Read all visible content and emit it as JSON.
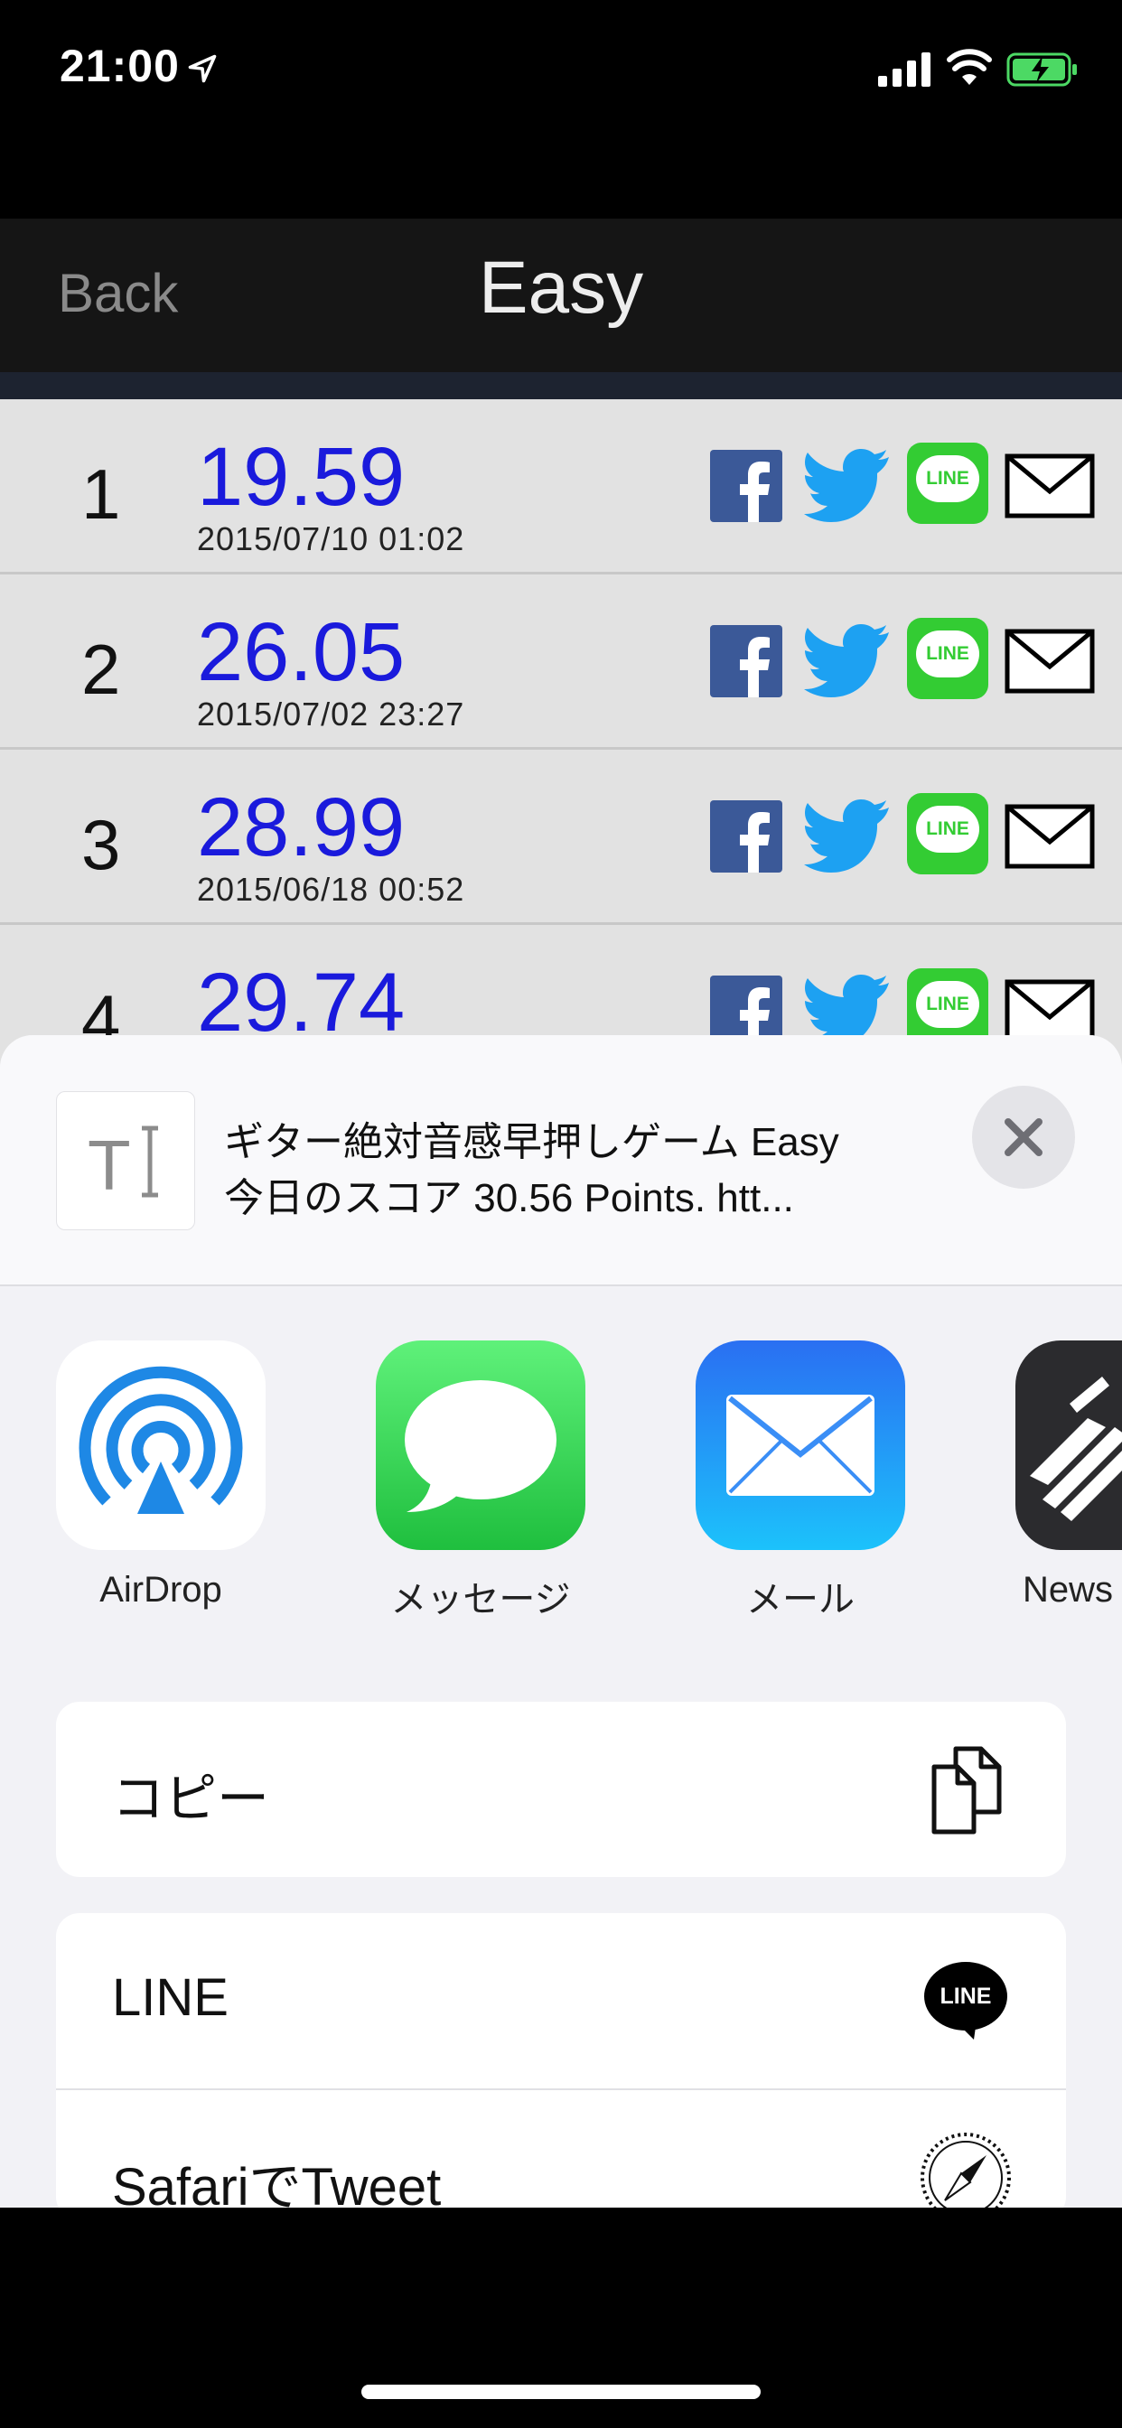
{
  "status_bar": {
    "time": "21:00",
    "icons": [
      "location-arrow-icon",
      "cellular-signal-icon",
      "wifi-icon",
      "battery-charging-icon"
    ],
    "battery_color": "#4cd964"
  },
  "nav": {
    "back_label": "Back",
    "title": "Easy"
  },
  "scores": [
    {
      "rank": "1",
      "score": "19.59",
      "date": "2015/07/10  01:02"
    },
    {
      "rank": "2",
      "score": "26.05",
      "date": "2015/07/02  23:27"
    },
    {
      "rank": "3",
      "score": "28.99",
      "date": "2015/06/18  00:52"
    },
    {
      "rank": "4",
      "score": "29.74",
      "date": ""
    }
  ],
  "row_share": {
    "icons": [
      "facebook-icon",
      "twitter-icon",
      "line-icon",
      "mail-icon"
    ],
    "line_badge_text": "LINE",
    "facebook_color": "#3b5998",
    "twitter_color": "#1da1f2",
    "line_color": "#33cc33"
  },
  "share_sheet": {
    "preview": {
      "line1": "ギター絶対音感早押しゲーム Easy",
      "line2": "今日のスコア  30.56 Points. htt..."
    },
    "apps": [
      {
        "label": "AirDrop",
        "icon": "airdrop-icon"
      },
      {
        "label": "メッセージ",
        "icon": "messages-icon"
      },
      {
        "label": "メール",
        "icon": "mail-app-icon"
      },
      {
        "label": "News",
        "icon": "news-icon"
      }
    ],
    "actions_group1": [
      {
        "label": "コピー",
        "icon": "copy-icon"
      }
    ],
    "actions_group2": [
      {
        "label": "LINE",
        "icon": "line-icon",
        "badge_text": "LINE"
      },
      {
        "label": "SafariでTweet",
        "icon": "safari-compass-icon"
      }
    ]
  },
  "colors": {
    "score_blue": "#1a1adc",
    "messages_green": "#2dc84d",
    "mail_blue": "#1e7cf5",
    "airdrop_blue": "#1e88e5"
  }
}
